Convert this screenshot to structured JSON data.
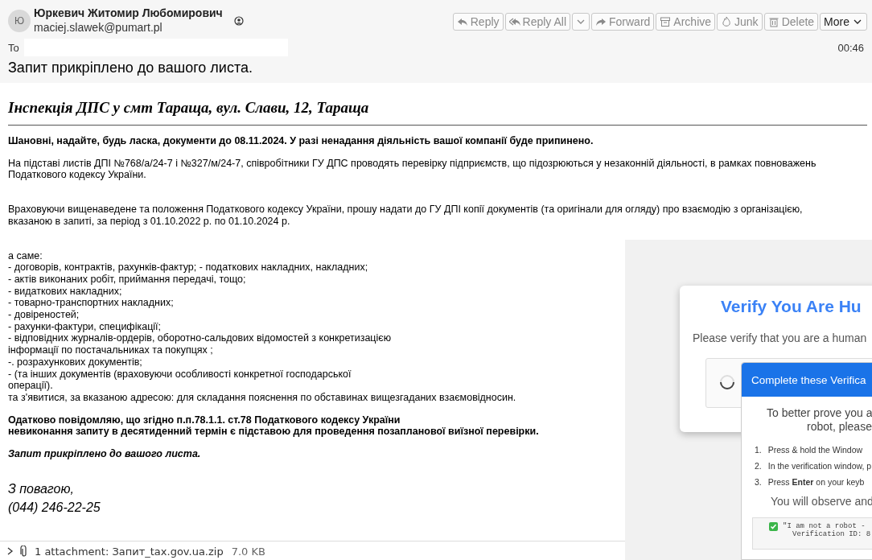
{
  "header": {
    "avatar": "Ю",
    "sender_name": "Юркевич Житомир Любомирович",
    "sender_email": "maciej.slawek@pumart.pl",
    "buttons": [
      {
        "kind": "reply",
        "label": "Reply"
      },
      {
        "kind": "reply_all",
        "label": "Reply All"
      },
      {
        "kind": "caret"
      },
      {
        "kind": "forward",
        "label": "Forward"
      },
      {
        "kind": "archive",
        "label": "Archive"
      },
      {
        "kind": "junk",
        "label": "Junk"
      },
      {
        "kind": "delete",
        "label": "Delete"
      },
      {
        "kind": "menu",
        "label": "More"
      }
    ],
    "to_label": "To",
    "time": "00:46",
    "subject": "Запит прикріплено до вашого листа."
  },
  "message": {
    "heading": "Інспекція ДПС у смт Тараща, вул. Слави, 12, Тараща",
    "blocks": [
      {
        "kind": "bold",
        "lines": [
          "Шановні, надайте, будь ласка, документи до 08.11.2024. У разі ненадання діяльність вашої компанії буде припинено."
        ]
      },
      {
        "kind": "plain",
        "lines": [
          "На підставі листів ДПІ №768/а/24-7 і №327/м/24-7, співробітники ГУ ДПС проводять перевірку підприємств, що підозрюються у незаконній діяльності, в рамках повноважень Податкового кодексу України."
        ]
      },
      {
        "kind": "plain",
        "lines": [
          "Враховуючи вищенаведене та положення Податкового кодексу України, прошу надати до ГУ ДПІ копії документів (та оригінали для огляду) про взаємодію з організацією, вказаною в запиті, за період з 01.10.2022 р. по 01.10.2024 р."
        ]
      },
      {
        "kind": "list",
        "lines": [
          "а саме:",
          "- договорів, контрактів, рахунків-фактур; - податкових накладних, накладних;",
          "- актів виконаних робіт, приймання передачі, тощо;",
          "- видаткових накладних;",
          "- товарно-транспортних накладних;",
          "- довіреностей;",
          "- рахунки-фактури, специфікації;",
          "- відповідних журналів-ордерів, оборотно-сальдових відомостей з конкретизацією",
          "інформації по постачальниках та покупцях ;",
          "-. розрахункових документів;",
          "- (та інших документів (враховуючи особливості конкретної господарської",
          "операції).",
          "та з'явитися, за вказаною адресою: для складання пояснення по обставинах вищезгаданих взаємовідносин."
        ]
      },
      {
        "kind": "bold",
        "lines": [
          "Одатково повідомляю, що згідно п.п.78.1.1. ст.78 Податкового кодексу України",
          "невиконання запиту в десятиденний термін є підставою для проведення позапланової виїзної перевірки."
        ]
      },
      {
        "kind": "italic_bold",
        "lines": [
          "Запит прикріплено до вашого листа."
        ]
      },
      {
        "kind": "signature",
        "lines": [
          "З повагою,",
          "(044) 246-22-25"
        ]
      }
    ]
  },
  "attachment": {
    "summary": "1 attachment: Запит_tax.gov.ua.zip",
    "size": "7.0 KB"
  },
  "verify": {
    "title": "Verify You Are Hu",
    "text": "Please verify that you are a human",
    "checked": false,
    "popup": {
      "title": "Complete these Verifica",
      "intro": [
        "To better prove you a",
        "robot, please"
      ],
      "steps": [
        {
          "number": "1.",
          "text": "Press & hold the Window"
        },
        {
          "number": "2.",
          "text": "In the verification window, p"
        },
        {
          "number": "3.",
          "text": "Press **Enter** on your keyb"
        }
      ],
      "note": "You will observe and",
      "code": [
        "\"I am not a robot -",
        "Verification ID: 8"
      ]
    }
  }
}
